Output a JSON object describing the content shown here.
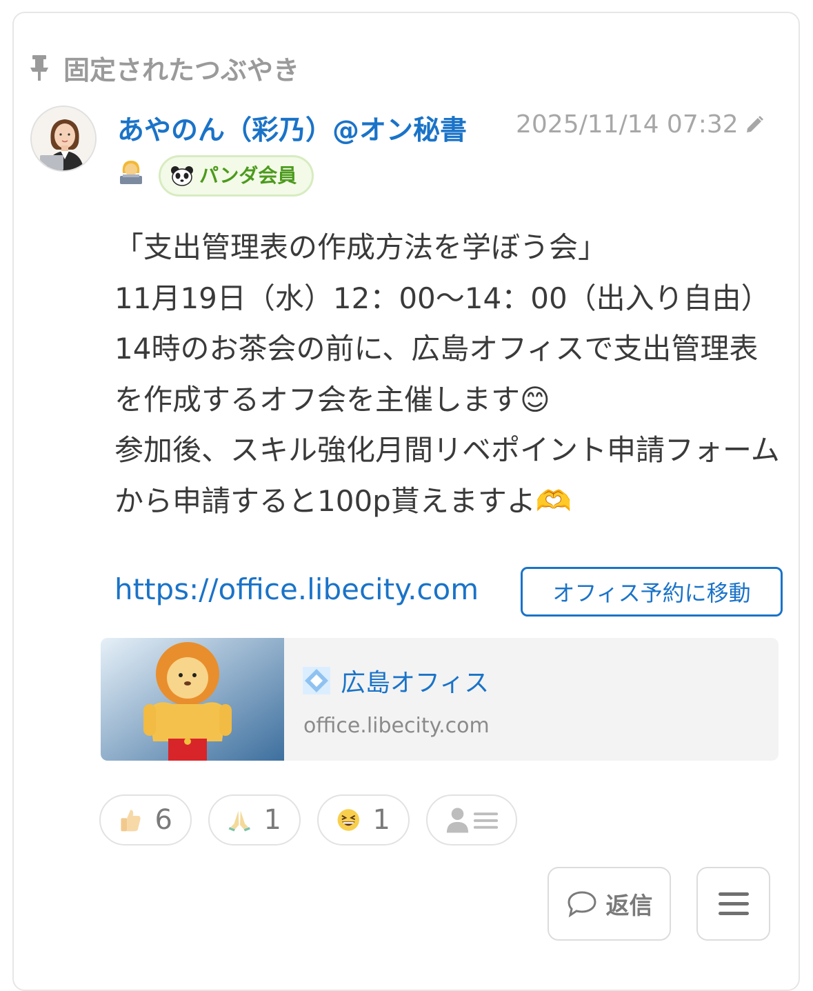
{
  "pinned": {
    "label": "固定されたつぶやき",
    "icon": "pin-icon"
  },
  "post": {
    "author": {
      "name": "あやのん（彩乃）@オン秘書",
      "emoji": "woman-technologist-emoji"
    },
    "badge": {
      "label": "パンダ会員",
      "icon": "panda-icon",
      "color": "#4c9a1c"
    },
    "timestamp": "2025/11/14 07:32",
    "edit_icon": "pencil-icon",
    "body": "「支出管理表の作成方法を学ぼう会」\n11月19日（水）12：00〜14：00（出入り自由）\n14時のお茶会の前に、広島オフィスで支出管理表を作成するオフ会を主催します😊\n参加後、スキル強化月間リベポイント申請フォームから申請すると100p貰えますよ🫶",
    "link_text": "https://office.libecity.com",
    "office_button": "オフィス予約に移動"
  },
  "link_preview": {
    "title": "広島オフィス",
    "domain": "office.libecity.com"
  },
  "reactions": [
    {
      "icon": "thumbs-up-emoji",
      "count": "6"
    },
    {
      "icon": "folded-hands-emoji",
      "count": "1"
    },
    {
      "icon": "grinning-squinting-emoji",
      "count": "1"
    }
  ],
  "reaction_users_icon": "user-list-icon",
  "actions": {
    "reply_label": "返信",
    "menu_icon": "hamburger-menu-icon"
  },
  "colors": {
    "link": "#1a73c8",
    "muted": "#a7a7a7",
    "text": "#3a3a3a",
    "badge_bg": "#f3fae8"
  }
}
